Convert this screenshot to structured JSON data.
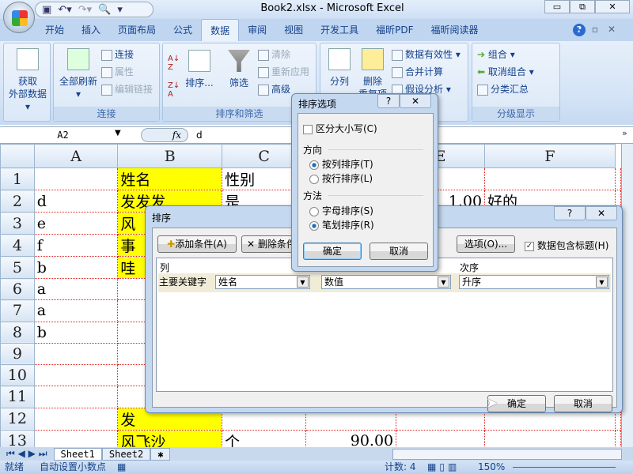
{
  "window": {
    "title": "Book2.xlsx - Microsoft Excel",
    "minimize": "▭",
    "restore": "⧉",
    "close": "✕"
  },
  "qat": {
    "icons": [
      "save-icon",
      "undo-icon",
      "redo-icon",
      "print-preview-icon",
      "customize-icon"
    ]
  },
  "tabs": [
    "开始",
    "插入",
    "页面布局",
    "公式",
    "数据",
    "审阅",
    "视图",
    "开发工具",
    "福昕PDF",
    "福昕阅读器"
  ],
  "active_tab": "数据",
  "ribbon": {
    "get_external": {
      "label": "获取\n外部数据",
      "line1": "获取",
      "line2": "外部数据 ▾"
    },
    "connections": {
      "refresh_all": "全部刷新",
      "connections": "连接",
      "properties": "属性",
      "edit_links": "编辑链接",
      "group": "连接"
    },
    "sort_filter": {
      "sort": "排序...",
      "filter": "筛选",
      "clear": "清除",
      "reapply": "重新应用",
      "advanced": "高级",
      "group": "排序和筛选"
    },
    "data_tools": {
      "text_to_columns": "分列",
      "remove_duplicates": "删除",
      "remove_duplicates_2": "重复项",
      "data_validation": "数据有效性 ▾",
      "consolidate": "合并计算",
      "what_if": "假设分析 ▾"
    },
    "outline": {
      "group_btn": "组合 ▾",
      "ungroup": "取消组合 ▾",
      "subtotal": "分类汇总",
      "group": "分级显示"
    }
  },
  "formula_bar": {
    "name_box": "A2",
    "fx": "fx",
    "value": "d"
  },
  "columns": [
    "A",
    "B",
    "C",
    "D",
    "E",
    "F"
  ],
  "rows": [
    {
      "n": "1",
      "cells": [
        "",
        "姓名",
        "性别",
        "",
        "",
        ""
      ]
    },
    {
      "n": "2",
      "cells": [
        "d",
        "发发发",
        "是",
        "",
        "1.00",
        "好的"
      ]
    },
    {
      "n": "3",
      "cells": [
        "e",
        "风",
        "",
        "",
        "",
        ""
      ]
    },
    {
      "n": "4",
      "cells": [
        "f",
        "事",
        "",
        "",
        "",
        ""
      ]
    },
    {
      "n": "5",
      "cells": [
        "b",
        "哇",
        "",
        "",
        "",
        ""
      ]
    },
    {
      "n": "6",
      "cells": [
        "a",
        "",
        "",
        "",
        "",
        ""
      ]
    },
    {
      "n": "7",
      "cells": [
        "a",
        "",
        "",
        "",
        "",
        ""
      ]
    },
    {
      "n": "8",
      "cells": [
        "b",
        "",
        "",
        "",
        "",
        ""
      ]
    },
    {
      "n": "9",
      "cells": [
        "",
        "",
        "",
        "",
        "",
        ""
      ]
    },
    {
      "n": "10",
      "cells": [
        "",
        "",
        "",
        "",
        "",
        ""
      ]
    },
    {
      "n": "11",
      "cells": [
        "",
        "",
        "",
        "",
        "",
        ""
      ]
    },
    {
      "n": "12",
      "cells": [
        "",
        "发",
        "",
        "",
        "",
        ""
      ]
    },
    {
      "n": "13",
      "cells": [
        "",
        "风飞沙",
        "个",
        "90.00",
        "",
        ""
      ]
    }
  ],
  "highlight_color": "#ffff00",
  "sheets": [
    "Sheet1",
    "Sheet2"
  ],
  "active_sheet": "Sheet1",
  "status": {
    "ready": "就绪",
    "fixed_decimal": "自动设置小数点",
    "count": "计数: 4",
    "zoom": "150%"
  },
  "sort_dialog": {
    "title": "排序",
    "help": "?",
    "close": "✕",
    "add_level": "添加条件(A)",
    "delete_level": "删除条件",
    "options": "选项(O)...",
    "has_headers": "数据包含标题(H)",
    "has_headers_checked": true,
    "col_header": "列",
    "order_header": "次序",
    "level": {
      "label": "主要关键字",
      "column": "姓名",
      "sort_on": "数值",
      "order": "升序"
    },
    "ok": "确定",
    "cancel": "取消"
  },
  "options_dialog": {
    "title": "排序选项",
    "help": "?",
    "close": "✕",
    "case_sensitive": "区分大小写(C)",
    "case_sensitive_checked": false,
    "orientation_label": "方向",
    "by_column": "按列排序(T)",
    "by_row": "按行排序(L)",
    "orientation": "按列排序",
    "method_label": "方法",
    "alphabetic": "字母排序(S)",
    "stroke": "笔划排序(R)",
    "method": "笔划排序",
    "ok": "确定",
    "cancel": "取消"
  }
}
